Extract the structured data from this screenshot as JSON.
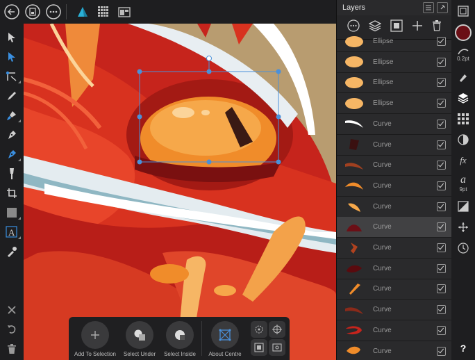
{
  "colors": {
    "accent": "#4a90d9",
    "background": "#1e1e20",
    "panel": "#2a2a2c",
    "selected_row": "#414143",
    "primary_color_swatch": "#6b0f16"
  },
  "topbar": {
    "icons": [
      "back-icon",
      "document-icon",
      "more-icon",
      "designer-persona-icon",
      "pixel-persona-icon",
      "export-persona-icon"
    ]
  },
  "tools": [
    "move-tool",
    "node-tool",
    "corner-tool",
    "pencil-tool",
    "vector-brush-tool",
    "pen-tool",
    "smart-pen-tool",
    "fill-tool",
    "crop-tool",
    "shape-tool",
    "text-tool",
    "color-picker-tool"
  ],
  "bottom_left": [
    "close-icon",
    "undo-icon",
    "trash-icon"
  ],
  "layers_panel": {
    "title": "Layers",
    "rows": [
      {
        "name": "Ellipse",
        "thumb": "ellipse",
        "selected": false
      },
      {
        "name": "Ellipse",
        "thumb": "ellipse",
        "selected": false
      },
      {
        "name": "Ellipse",
        "thumb": "ellipse",
        "selected": false
      },
      {
        "name": "Ellipse",
        "thumb": "ellipse",
        "selected": false
      },
      {
        "name": "Curve",
        "thumb": "white-swoosh",
        "selected": false
      },
      {
        "name": "Curve",
        "thumb": "dark-blob",
        "selected": false
      },
      {
        "name": "Curve",
        "thumb": "brown-arc",
        "selected": false
      },
      {
        "name": "Curve",
        "thumb": "orange-leaf",
        "selected": false
      },
      {
        "name": "Curve",
        "thumb": "orange-petal",
        "selected": false
      },
      {
        "name": "Curve",
        "thumb": "maroon-shape",
        "selected": true
      },
      {
        "name": "Curve",
        "thumb": "brown-bent",
        "selected": false
      },
      {
        "name": "Curve",
        "thumb": "dark-red-blob",
        "selected": false
      },
      {
        "name": "Curve",
        "thumb": "orange-tusk",
        "selected": false
      },
      {
        "name": "Curve",
        "thumb": "red-arc",
        "selected": false
      },
      {
        "name": "Curve",
        "thumb": "red-loop",
        "selected": false
      },
      {
        "name": "Curve",
        "thumb": "orange-drop",
        "selected": false
      }
    ]
  },
  "studio": {
    "stroke_width": "0.2pt",
    "text_size": "9pt",
    "help": "?"
  },
  "context_toolbar": {
    "buttons": [
      {
        "label": "Add To Selection",
        "icon": "plus-icon"
      },
      {
        "label": "Select Under",
        "icon": "select-under-icon"
      },
      {
        "label": "Select Inside",
        "icon": "select-inside-icon"
      },
      {
        "label": "About Centre",
        "icon": "about-centre-icon"
      }
    ]
  }
}
